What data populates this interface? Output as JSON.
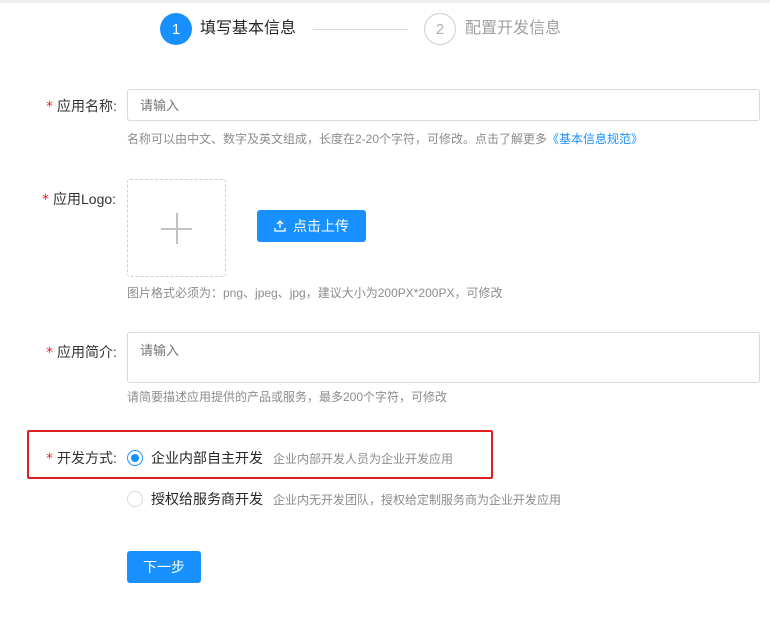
{
  "steps": [
    {
      "number": "1",
      "label": "填写基本信息",
      "state": "active"
    },
    {
      "number": "2",
      "label": "配置开发信息",
      "state": "inactive"
    }
  ],
  "form": {
    "required_mark": "*",
    "app_name": {
      "label": "应用名称:",
      "placeholder": "请输入",
      "hint": "名称可以由中文、数字及英文组成，长度在2-20个字符，可修改。点击了解更多",
      "hint_link": "《基本信息规范》"
    },
    "app_logo": {
      "label": "应用Logo:",
      "upload_button": "点击上传",
      "hint": "图片格式必须为：png、jpeg、jpg，建议大小为200PX*200PX，可修改"
    },
    "app_intro": {
      "label": "应用简介:",
      "placeholder": "请输入",
      "hint": "请简要描述应用提供的产品或服务，最多200个字符，可修改"
    },
    "dev_mode": {
      "label": "开发方式:",
      "options": [
        {
          "label": "企业内部自主开发",
          "desc": "企业内部开发人员为企业开发应用",
          "checked": true
        },
        {
          "label": "授权给服务商开发",
          "desc": "企业内无开发团队，授权给定制服务商为企业开发应用",
          "checked": false
        }
      ]
    },
    "next_button": "下一步"
  },
  "colors": {
    "primary": "#1890ff",
    "required": "#f5222d",
    "highlight": "#e02020"
  },
  "icons": [
    "plus-icon",
    "upload-icon"
  ]
}
